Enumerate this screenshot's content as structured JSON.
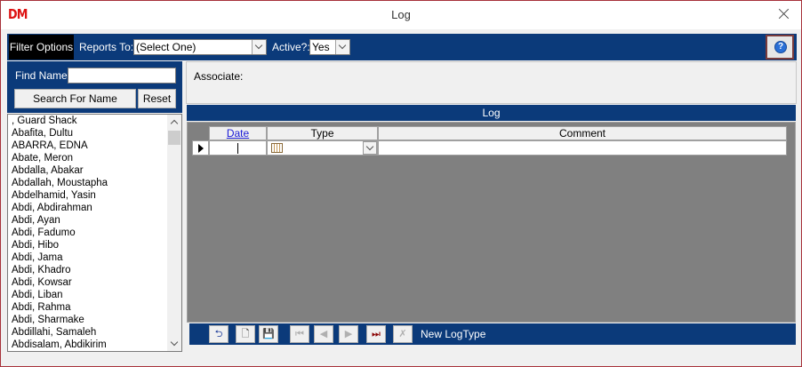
{
  "window": {
    "logo": "DM",
    "title": "Log"
  },
  "filter": {
    "tab_label": "Filter Options",
    "reports_to_label": "Reports To:",
    "reports_to_value": "(Select One)",
    "active_label": "Active?:",
    "active_value": "Yes"
  },
  "search": {
    "find_label": "Find Name:",
    "find_value": "",
    "search_button": "Search For Name",
    "reset_button": "Reset"
  },
  "names": [
    ", Guard Shack",
    "Abafita, Dultu",
    "ABARRA, EDNA",
    "Abate, Meron",
    "Abdalla, Abakar",
    "Abdallah, Moustapha",
    "Abdelhamid, Yasin",
    "Abdi, Abdirahman",
    "Abdi, Ayan",
    "Abdi, Fadumo",
    "Abdi, Hibo",
    "Abdi, Jama",
    "Abdi, Khadro",
    "Abdi, Kowsar",
    "Abdi, Liban",
    "Abdi, Rahma",
    "Abdi, Sharmake",
    "Abdillahi, Samaleh",
    "Abdisalam, Abdikirim"
  ],
  "associate": {
    "label": "Associate:"
  },
  "log": {
    "header": "Log",
    "columns": {
      "date": "Date",
      "type": "Type",
      "comment": "Comment"
    }
  },
  "nav": {
    "new_logtype": "New LogType"
  }
}
